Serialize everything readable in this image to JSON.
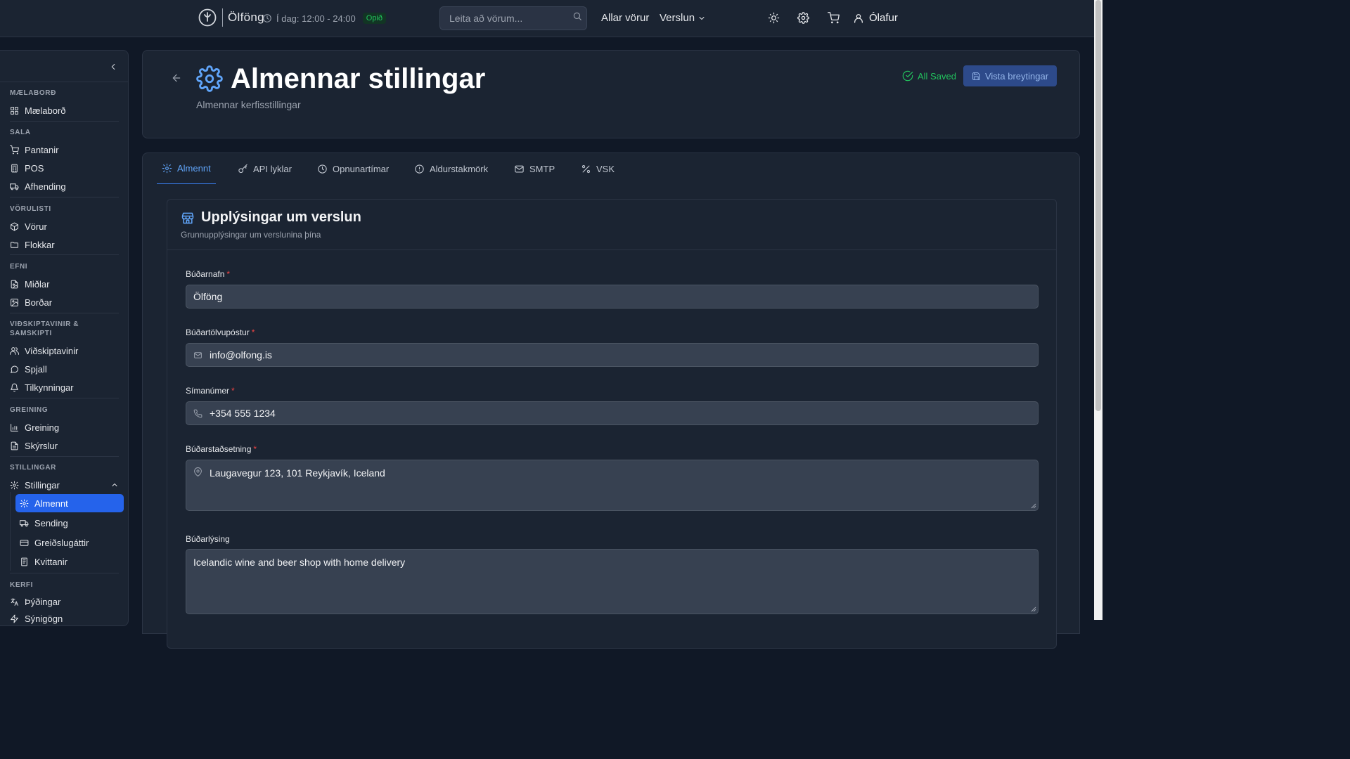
{
  "topbar": {
    "logo_text": "Ölföng",
    "hours": "Í dag: 12:00 - 24:00",
    "open_badge": "Opið",
    "search_placeholder": "Leita að vörum...",
    "all_products": "Allar vörur",
    "store_menu": "Verslun",
    "user_name": "Ólafur"
  },
  "sidebar": {
    "sections": [
      {
        "title": "MÆLABORÐ",
        "items": [
          {
            "label": "Mælaborð",
            "icon": "dashboard-icon"
          }
        ]
      },
      {
        "title": "SALA",
        "items": [
          {
            "label": "Pantanir",
            "icon": "cart-icon"
          },
          {
            "label": "POS",
            "icon": "calculator-icon"
          },
          {
            "label": "Afhending",
            "icon": "truck-icon"
          }
        ]
      },
      {
        "title": "VÖRULISTI",
        "items": [
          {
            "label": "Vörur",
            "icon": "package-icon"
          },
          {
            "label": "Flokkar",
            "icon": "folder-icon"
          }
        ]
      },
      {
        "title": "EFNI",
        "items": [
          {
            "label": "Miðlar",
            "icon": "file-image-icon"
          },
          {
            "label": "Borðar",
            "icon": "image-icon"
          }
        ]
      },
      {
        "title": "VIÐSKIPTAVINIR & SAMSKIPTI",
        "items": [
          {
            "label": "Viðskiptavinir",
            "icon": "users-icon"
          },
          {
            "label": "Spjall",
            "icon": "chat-icon"
          },
          {
            "label": "Tilkynningar",
            "icon": "bell-icon"
          }
        ]
      },
      {
        "title": "GREINING",
        "items": [
          {
            "label": "Greining",
            "icon": "bar-chart-icon"
          },
          {
            "label": "Skýrslur",
            "icon": "report-icon"
          }
        ]
      },
      {
        "title": "STILLINGAR",
        "items": [
          {
            "label": "Stillingar",
            "icon": "gear-icon"
          }
        ]
      },
      {
        "title": "KERFI",
        "items": [
          {
            "label": "Þýðingar",
            "icon": "translate-icon"
          },
          {
            "label": "Sýnigögn",
            "icon": "bolt-icon"
          }
        ]
      }
    ],
    "settings_sub": [
      {
        "label": "Almennt",
        "icon": "gear-icon",
        "active": true
      },
      {
        "label": "Sending",
        "icon": "truck-icon",
        "active": false
      },
      {
        "label": "Greiðslugáttir",
        "icon": "credit-card-icon",
        "active": false
      },
      {
        "label": "Kvittanir",
        "icon": "receipt-icon",
        "active": false
      }
    ]
  },
  "header": {
    "title": "Almennar stillingar",
    "subtitle": "Almennar kerfisstillingar",
    "saved_status": "All Saved",
    "save_button": "Vista breytingar"
  },
  "tabs": [
    {
      "label": "Almennt",
      "icon": "gear-icon",
      "active": true
    },
    {
      "label": "API lyklar",
      "icon": "key-icon",
      "active": false
    },
    {
      "label": "Opnunartímar",
      "icon": "clock-icon",
      "active": false
    },
    {
      "label": "Aldurstakmörk",
      "icon": "alert-circle-icon",
      "active": false
    },
    {
      "label": "SMTP",
      "icon": "mail-icon",
      "active": false
    },
    {
      "label": "VSK",
      "icon": "percent-icon",
      "active": false
    }
  ],
  "store_section": {
    "title": "Upplýsingar um verslun",
    "subtitle": "Grunnupplýsingar um verslunina þína",
    "fields": {
      "name": {
        "label": "Búðarnafn",
        "value": "Ölföng",
        "required": true
      },
      "email": {
        "label": "Búðartölvupóstur",
        "value": "info@olfong.is",
        "required": true
      },
      "phone": {
        "label": "Símanúmer",
        "value": "+354 555 1234",
        "required": true
      },
      "address": {
        "label": "Búðarstaðsetning",
        "value": "Laugavegur 123, 101 Reykjavík, Iceland",
        "required": true
      },
      "description": {
        "label": "Búðarlýsing",
        "value": "Icelandic wine and beer shop with home delivery",
        "required": false
      }
    }
  },
  "colors": {
    "accent": "#2563eb",
    "accent_text": "#60a5fa",
    "success": "#22c55e",
    "required": "#ef4444"
  }
}
